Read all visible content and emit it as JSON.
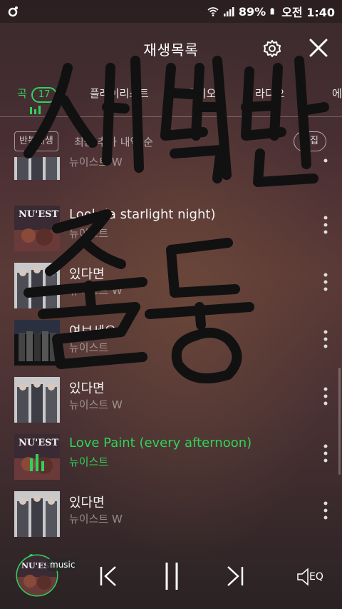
{
  "status_bar": {
    "battery": "89%",
    "time": "오전 1:40"
  },
  "header": {
    "title": "재생목록"
  },
  "tabs": [
    {
      "label": "곡",
      "count": "17",
      "active": true
    },
    {
      "label": "플레이리스트"
    },
    {
      "label": "오디오"
    },
    {
      "label": "라디오"
    },
    {
      "label": "에"
    }
  ],
  "controls": {
    "play_all_label": "반복재생",
    "sort_label": "최근 추가 내역 순",
    "edit_label": "편집"
  },
  "songs": [
    {
      "title": "",
      "artist": "뉴이스트 W",
      "art": "w"
    },
    {
      "title": "Look (a starlight night)",
      "artist": "뉴이스트",
      "art": "nuest"
    },
    {
      "title": "있다면",
      "artist": "뉴이스트 W",
      "art": "w"
    },
    {
      "title": "여보세요",
      "artist": "뉴이스트",
      "art": "group"
    },
    {
      "title": "있다면",
      "artist": "뉴이스트 W",
      "art": "w"
    },
    {
      "title": "Love Paint (every afternoon)",
      "artist": "뉴이스트",
      "art": "nuest",
      "playing": true
    },
    {
      "title": "있다면",
      "artist": "뉴이스트 W",
      "art": "w"
    }
  ],
  "player": {
    "badge": "music",
    "eq_label": "EQ"
  },
  "handwriting_text": "새벽반 출동",
  "colors": {
    "accent": "#2fd35a",
    "text": "#ffffff"
  }
}
